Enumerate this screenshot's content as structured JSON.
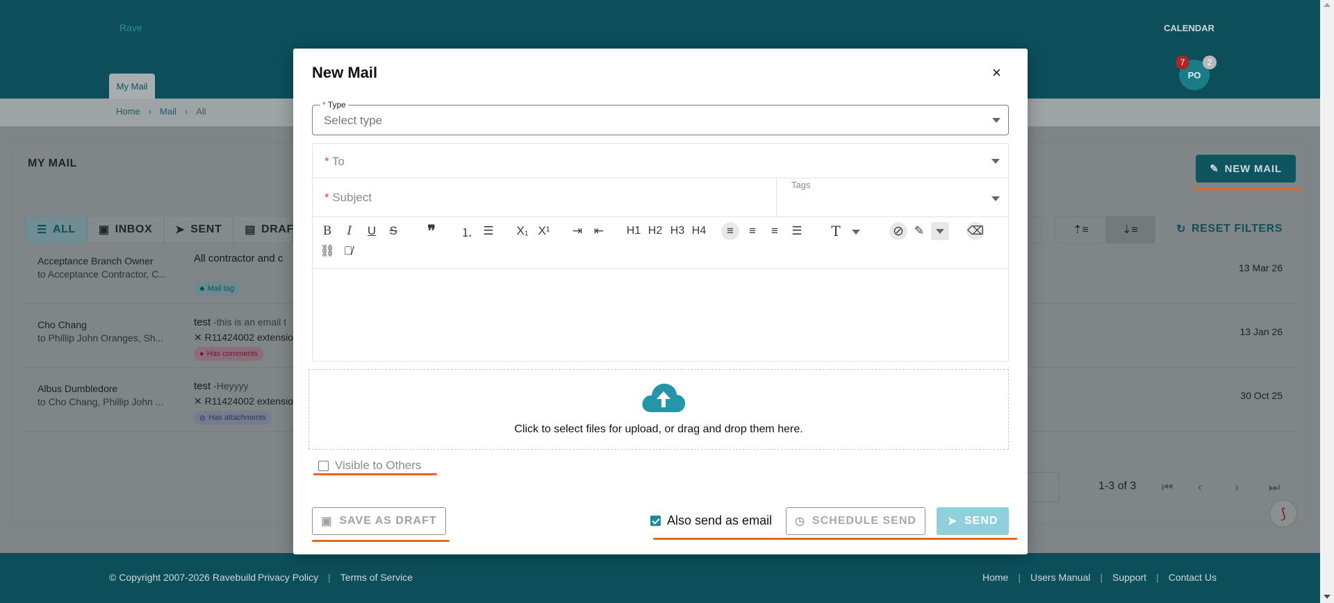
{
  "header": {
    "brand": "Rave",
    "calendar_label": "CALENDAR",
    "avatar_initials": "PO",
    "notification_count": "7",
    "message_count": "2",
    "active_tab": "My Mail"
  },
  "breadcrumb": [
    "Home",
    "Mail",
    "All"
  ],
  "page": {
    "title": "MY MAIL",
    "new_mail_label": "NEW MAIL",
    "filters": [
      "ALL",
      "INBOX",
      "SENT",
      "DRAF"
    ],
    "reset_filters_label": "RESET FILTERS",
    "pagination_range": "1-3 of 3"
  },
  "mail_rows": [
    {
      "from": "Acceptance Branch Owner",
      "to": "to Acceptance Contractor, C...",
      "subject": "All contractor and c",
      "preview": "",
      "reference": "",
      "tag": "Mail tag",
      "date": "13 Mar 26"
    },
    {
      "from": "Cho Chang",
      "to": "to Phillip John Oranges, Sh...",
      "subject": "test",
      "preview": " -this is an email t",
      "reference": "R11424002 extensio",
      "tag": "Has comments",
      "date": "13 Jan 26"
    },
    {
      "from": "Albus Dumbledore",
      "to": "to Cho Chang, Phillip John ...",
      "subject": "test",
      "preview": " -Heyyyy",
      "reference": "R11424002 extensio",
      "tag": "Has attachments",
      "date": "30 Oct 25"
    }
  ],
  "footer": {
    "copyright": "© Copyright 2007-2026 Ravebuild",
    "left_links": [
      "Privacy Policy",
      "Terms of Service"
    ],
    "right_links": [
      "Home",
      "Users Manual",
      "Support",
      "Contact Us"
    ]
  },
  "modal": {
    "title": "New Mail",
    "close_glyph": "×",
    "type_label": "Type",
    "type_placeholder": "Select type",
    "to_placeholder": "To",
    "subject_placeholder": "Subject",
    "tags_placeholder": "Tags",
    "toolbar": [
      "bold",
      "italic",
      "underline",
      "strikethrough",
      "blockquote",
      "ordered-list",
      "bullet-list",
      "subscript",
      "superscript",
      "indent",
      "outdent",
      "H1",
      "H2",
      "H3",
      "H4",
      "align-left",
      "align-center",
      "align-right",
      "justify",
      "font-size",
      "clear-color",
      "highlight",
      "eraser",
      "link",
      "unlink"
    ],
    "heading_labels": [
      "H1",
      "H2",
      "H3",
      "H4"
    ],
    "dropzone_text": "Click to select files for upload, or drag and drop them here.",
    "visible_to_others_label": "Visible to Others",
    "visible_to_others_checked": false,
    "save_draft_label": "SAVE AS DRAFT",
    "also_send_email_label": "Also send as email",
    "also_send_email_checked": true,
    "schedule_send_label": "SCHEDULE SEND",
    "send_label": "SEND"
  },
  "colors": {
    "brand_dark": "#0c4f5b",
    "accent": "#1f8a99",
    "send_disabled": "#8fd0da",
    "highlight_underline": "#e8651c",
    "required": "#e8412c"
  }
}
